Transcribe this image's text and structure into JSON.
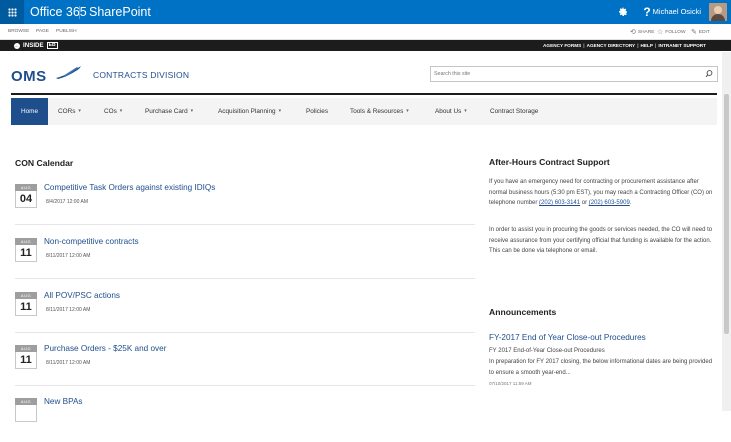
{
  "suite_bar": {
    "brand": "Office 365",
    "app_name": "SharePoint",
    "settings_icon": "gear-icon",
    "help_label": "?",
    "user_name": "Michael Osicki"
  },
  "ribbon": {
    "tabs": [
      "BROWSE",
      "PAGE",
      "PUBLISH"
    ],
    "actions": [
      {
        "label": "SHARE",
        "icon": "share-icon"
      },
      {
        "label": "FOLLOW",
        "icon": "star-icon"
      },
      {
        "label": "EDIT",
        "icon": "pencil-icon"
      }
    ]
  },
  "top_bar": {
    "logo_text": "INSIDE",
    "logo_box": "EB",
    "links": [
      "AGENCY FORMS",
      "AGENCY DIRECTORY",
      "HELP",
      "INTRANET SUPPORT"
    ]
  },
  "header": {
    "logo_text": "OMS",
    "site_title": "CONTRACTS DIVISION",
    "search_placeholder": "Search this site"
  },
  "nav": {
    "items": [
      {
        "label": "Home",
        "active": true
      },
      {
        "label": "CORs",
        "caret": "▾"
      },
      {
        "label": "COs",
        "caret": "▾"
      },
      {
        "label": "Purchase Card",
        "caret": "▾"
      },
      {
        "label": "Acquisition Planning",
        "caret": "▾"
      },
      {
        "label": "Policies"
      },
      {
        "label": "Tools & Resources",
        "caret": "▾"
      },
      {
        "label": "About Us",
        "caret": "▾"
      },
      {
        "label": "Contract Storage"
      }
    ]
  },
  "calendar": {
    "title": "CON Calendar",
    "events": [
      {
        "month": "AUG",
        "day": "04",
        "title": "Competitive Task Orders against existing IDIQs",
        "date": "8/4/2017 12:00 AM"
      },
      {
        "month": "AUG",
        "day": "11",
        "title": "Non-competitive contracts",
        "date": "8/11/2017 12:00 AM"
      },
      {
        "month": "AUG",
        "day": "11",
        "title": "All POV/PSC actions",
        "date": "8/11/2017 12:00 AM"
      },
      {
        "month": "AUG",
        "day": "11",
        "title": "Purchase Orders - $25K and over",
        "date": "8/11/2017 12:00 AM"
      },
      {
        "month": "AUG",
        "day": "",
        "title": "New BPAs",
        "date": ""
      }
    ]
  },
  "support": {
    "title": "After-Hours Contract Support",
    "para1_a": "If you have an emergency need for contracting or procurement assistance after normal business hours (5:30 pm EST), you may reach a Contracting Officer (CO) on telephone number ",
    "phone1": "(202) 603-3141",
    "para1_b": " or ",
    "phone2": "(202) 603-5909",
    "para1_c": ".",
    "para2": "In order to assist you in procuring the goods or services needed, the CO will need to receive assurance from your certifying official that funding is available for the action. This can be done via telephone or email."
  },
  "announcements": {
    "title": "Announcements",
    "item_title": "FY-2017 End of Year Close-out Procedures",
    "item_sub": "FY 2017 End-of-Year Close-out Procedures",
    "item_body": "In preparation for FY 2017 closing, the below informational dates are being provided to ensure a smooth year-end...",
    "item_date": "07/10/2017 11:59 AM"
  },
  "colors": {
    "suite_blue": "#0072c6",
    "brand_navy": "#1f4e8c",
    "top_bar": "#1c1c1c"
  }
}
